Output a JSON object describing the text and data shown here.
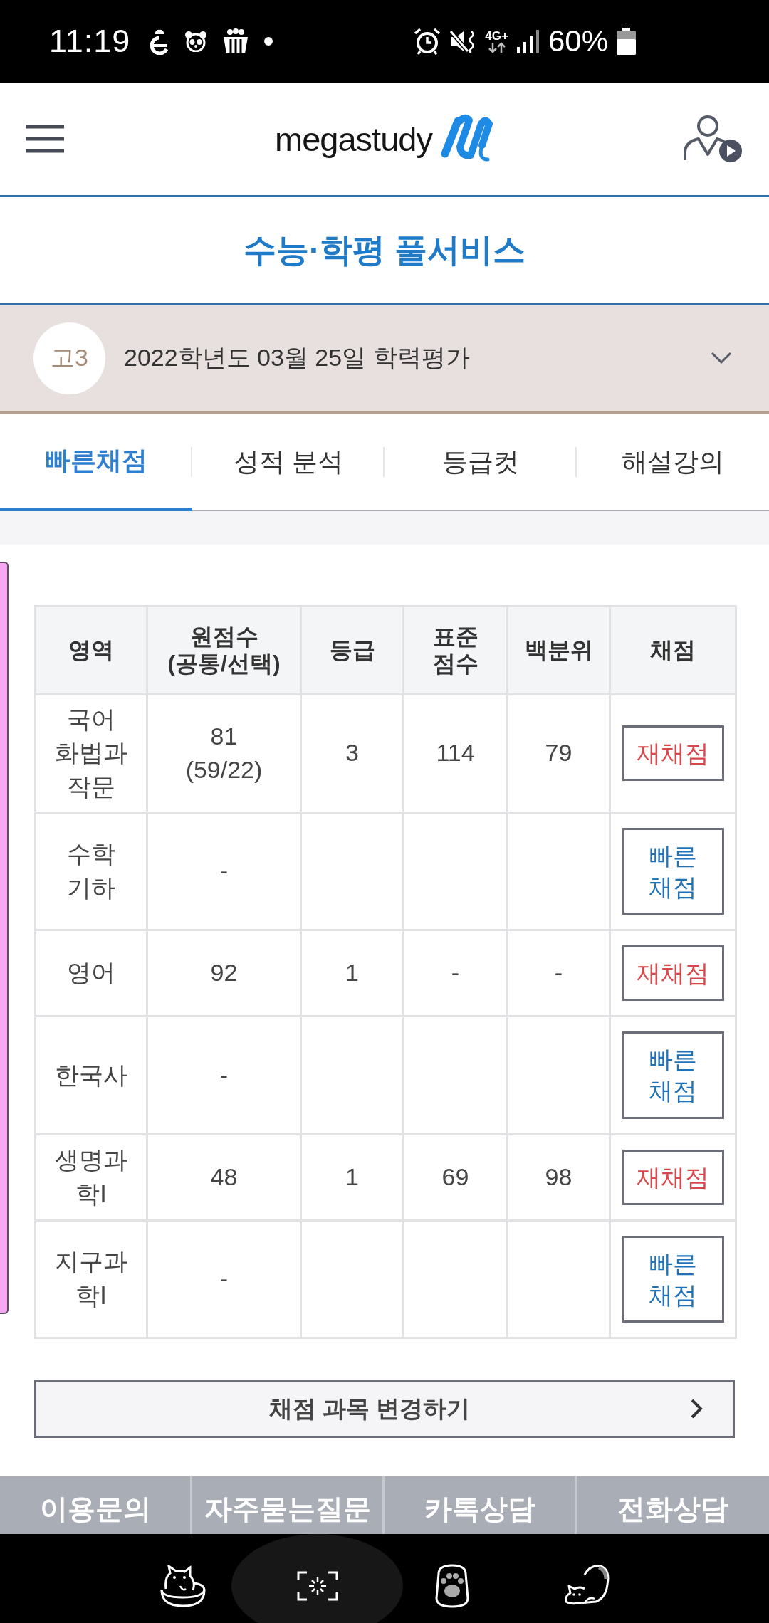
{
  "status_bar": {
    "time": "11:19",
    "network": "4G+",
    "battery": "60%"
  },
  "header": {
    "logo_text": "megastudy"
  },
  "page_title": "수능·학평 풀서비스",
  "exam_selector": {
    "grade": "고3",
    "exam": "2022학년도 03월 25일 학력평가"
  },
  "tabs": [
    {
      "label": "빠른채점",
      "selected": true
    },
    {
      "label": "성적 분석",
      "selected": false
    },
    {
      "label": "등급컷",
      "selected": false
    },
    {
      "label": "해설강의",
      "selected": false
    }
  ],
  "score_table": {
    "columns": [
      "영역",
      "원점수\n(공통/선택)",
      "등급",
      "표준\n점수",
      "백분위",
      "채점"
    ],
    "rows": [
      {
        "subject": "국어\n화법과작문",
        "raw_score": "81\n(59/22)",
        "grade": "3",
        "standard_score": "114",
        "percentile": "79",
        "action": {
          "kind": "regrade",
          "label": "재채점"
        }
      },
      {
        "subject": "수학\n기하",
        "raw_score": "-",
        "action": {
          "kind": "quick",
          "label": "빠른\n채점"
        }
      },
      {
        "subject": "영어",
        "raw_score": "92",
        "grade": "1",
        "standard_score": "-",
        "percentile": "-",
        "action": {
          "kind": "regrade",
          "label": "재채점"
        }
      },
      {
        "subject": "한국사",
        "raw_score": "-",
        "action": {
          "kind": "quick",
          "label": "빠른\n채점"
        }
      },
      {
        "subject": "생명과학Ⅰ",
        "raw_score": "48",
        "grade": "1",
        "standard_score": "69",
        "percentile": "98",
        "action": {
          "kind": "regrade",
          "label": "재채점"
        }
      },
      {
        "subject": "지구과학Ⅰ",
        "raw_score": "-",
        "action": {
          "kind": "quick",
          "label": "빠른\n채점"
        }
      }
    ]
  },
  "change_subjects_button": "채점 과목 변경하기",
  "footer_links": [
    "이용문의",
    "자주묻는질문",
    "카톡상담",
    "전화상담"
  ]
}
